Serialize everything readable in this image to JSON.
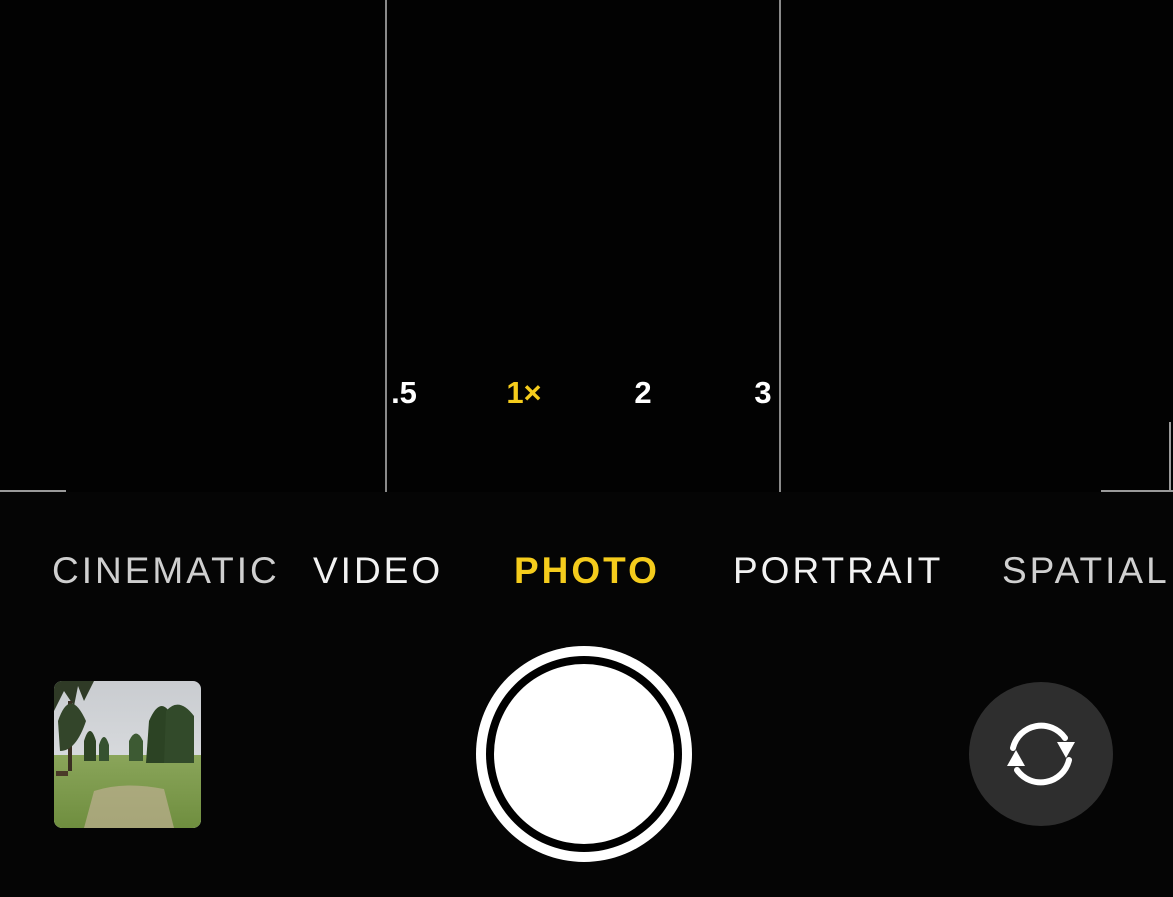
{
  "zoom": {
    "options": [
      {
        "label": ".5",
        "active": false
      },
      {
        "label": "1×",
        "active": true
      },
      {
        "label": "2",
        "active": false
      },
      {
        "label": "3",
        "active": false
      }
    ]
  },
  "modes": [
    {
      "label": "CINEMATIC",
      "active": false
    },
    {
      "label": "VIDEO",
      "active": false
    },
    {
      "label": "PHOTO",
      "active": true
    },
    {
      "label": "PORTRAIT",
      "active": false
    },
    {
      "label": "SPATIAL",
      "active": false
    }
  ],
  "thumbnail": {
    "icon": "last-photo-thumbnail"
  },
  "shutter": {
    "icon": "shutter-button"
  },
  "flip": {
    "icon": "camera-flip-icon"
  },
  "colors": {
    "accent": "#f5cc1c",
    "background": "#000000",
    "flip_button_bg": "#2e2e2e"
  }
}
